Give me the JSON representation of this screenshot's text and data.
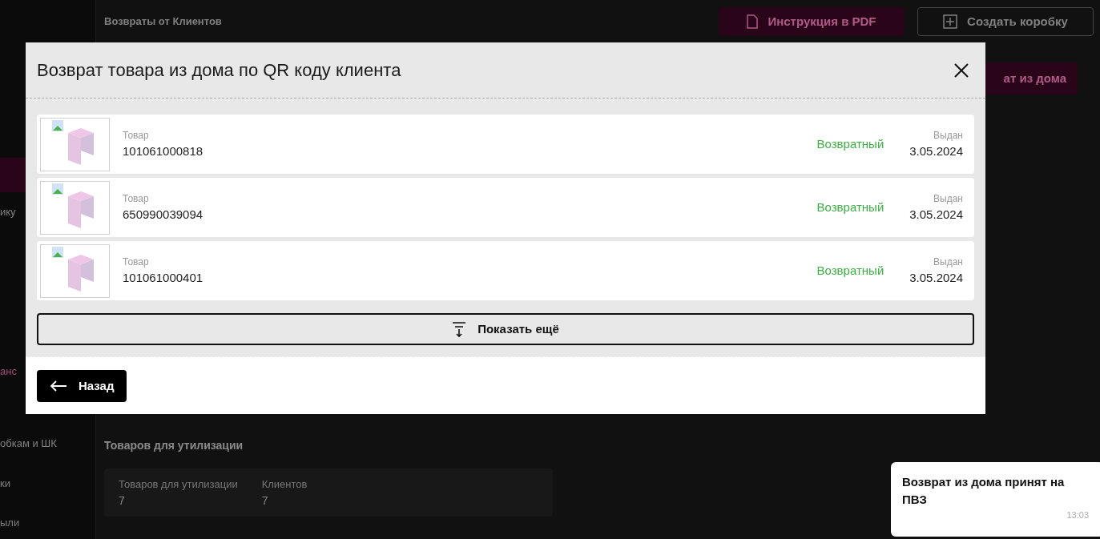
{
  "page": {
    "title": "Возвраты от Клиентов",
    "pdf_button": "Инструкция в PDF",
    "create_box_button": "Создать коробку",
    "home_return_button": "ат из дома"
  },
  "sidebar": {
    "items": [
      {
        "selected": true
      },
      {
        "label": "ику",
        "selected": false
      },
      {
        "label": "анс",
        "selected": false
      },
      {
        "label": "обкам и ШК",
        "selected": false
      },
      {
        "label": "ки",
        "selected": false
      },
      {
        "label": "ыли",
        "selected": false
      }
    ]
  },
  "disposal": {
    "heading": "Товаров для утилизации",
    "stats": [
      {
        "label": "Товаров для утилизации",
        "value": "7"
      },
      {
        "label": "Клиентов",
        "value": "7"
      }
    ]
  },
  "dialog": {
    "title": "Возврат товара из дома по QR коду клиента",
    "items": [
      {
        "label": "Товар",
        "code": "101061000818",
        "status": "Возвратный",
        "date_label": "Выдан",
        "date": "3.05.2024"
      },
      {
        "label": "Товар",
        "code": "650990039094",
        "status": "Возвратный",
        "date_label": "Выдан",
        "date": "3.05.2024"
      },
      {
        "label": "Товар",
        "code": "101061000401",
        "status": "Возвратный",
        "date_label": "Выдан",
        "date": "3.05.2024"
      }
    ],
    "show_more": "Показать ещё",
    "back": "Назад"
  },
  "toast": {
    "message": "Возврат из дома принят на ПВЗ",
    "time": "13:03"
  }
}
